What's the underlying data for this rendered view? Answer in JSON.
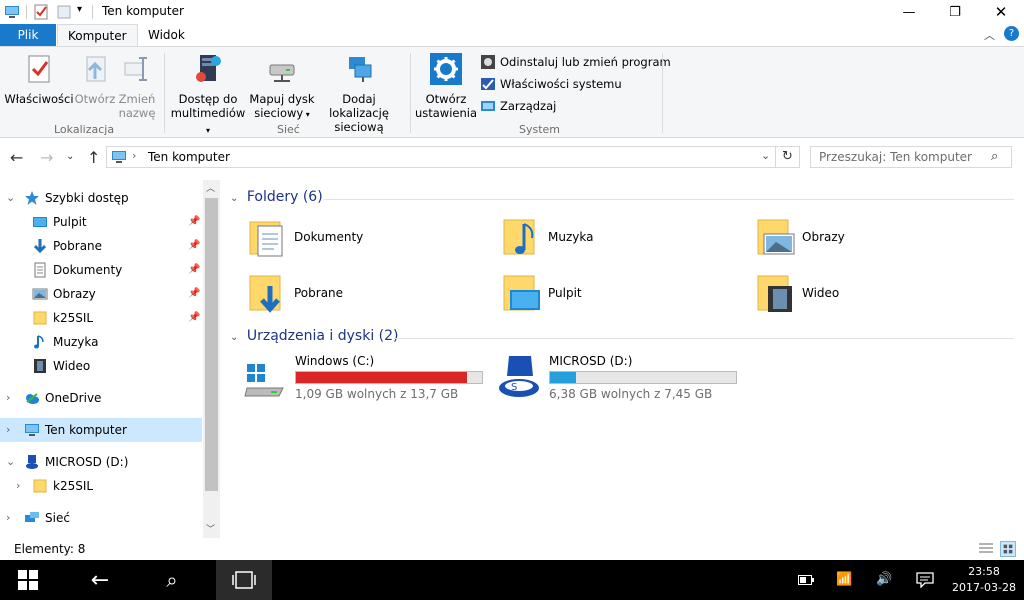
{
  "window": {
    "title": "Ten komputer"
  },
  "ribbon_tabs": {
    "file": "Plik",
    "computer": "Komputer",
    "view": "Widok"
  },
  "ribbon": {
    "properties": "Właściwości",
    "open": "Otwórz",
    "rename_line1": "Zmień",
    "rename_line2": "nazwę",
    "group_location": "Lokalizacja",
    "media_line1": "Dostęp do",
    "media_line2": "multimediów",
    "map_line1": "Mapuj dysk",
    "map_line2": "sieciowy",
    "addnet_line1": "Dodaj lokalizację",
    "addnet_line2": "sieciową",
    "group_network": "Sieć",
    "settings_line1": "Otwórz",
    "settings_line2": "ustawienia",
    "uninstall": "Odinstaluj lub zmień program",
    "sysprops": "Właściwości systemu",
    "manage": "Zarządzaj",
    "group_system": "System"
  },
  "address": {
    "path": "Ten komputer",
    "search_placeholder": "Przeszukaj: Ten komputer"
  },
  "nav": {
    "quick_access": "Szybki dostęp",
    "desktop": "Pulpit",
    "downloads": "Pobrane",
    "documents": "Dokumenty",
    "pictures": "Obrazy",
    "k25sil": "k25SIL",
    "music": "Muzyka",
    "videos": "Wideo",
    "onedrive": "OneDrive",
    "this_pc": "Ten komputer",
    "microsd": "MICROSD (D:)",
    "k25sil_sub": "k25SIL",
    "network": "Sieć"
  },
  "folders_header": "Foldery (6)",
  "folders": [
    "Dokumenty",
    "Muzyka",
    "Obrazy",
    "Pobrane",
    "Pulpit",
    "Wideo"
  ],
  "devices_header": "Urządzenia i dyski (2)",
  "drives": [
    {
      "name": "Windows (C:)",
      "free": "1,09 GB wolnych z 13,7 GB",
      "used_fraction": 0.92,
      "color": "#da2626"
    },
    {
      "name": "MICROSD (D:)",
      "free": "6,38 GB wolnych z 7,45 GB",
      "used_fraction": 0.14,
      "color": "#26a0da"
    }
  ],
  "status": {
    "items": "Elementy: 8"
  },
  "taskbar": {
    "time": "23:58",
    "date": "2017-03-28"
  },
  "colors": {
    "accent": "#1979ca",
    "selection": "#cce8ff",
    "folder_yellow": "#ffd86b"
  }
}
